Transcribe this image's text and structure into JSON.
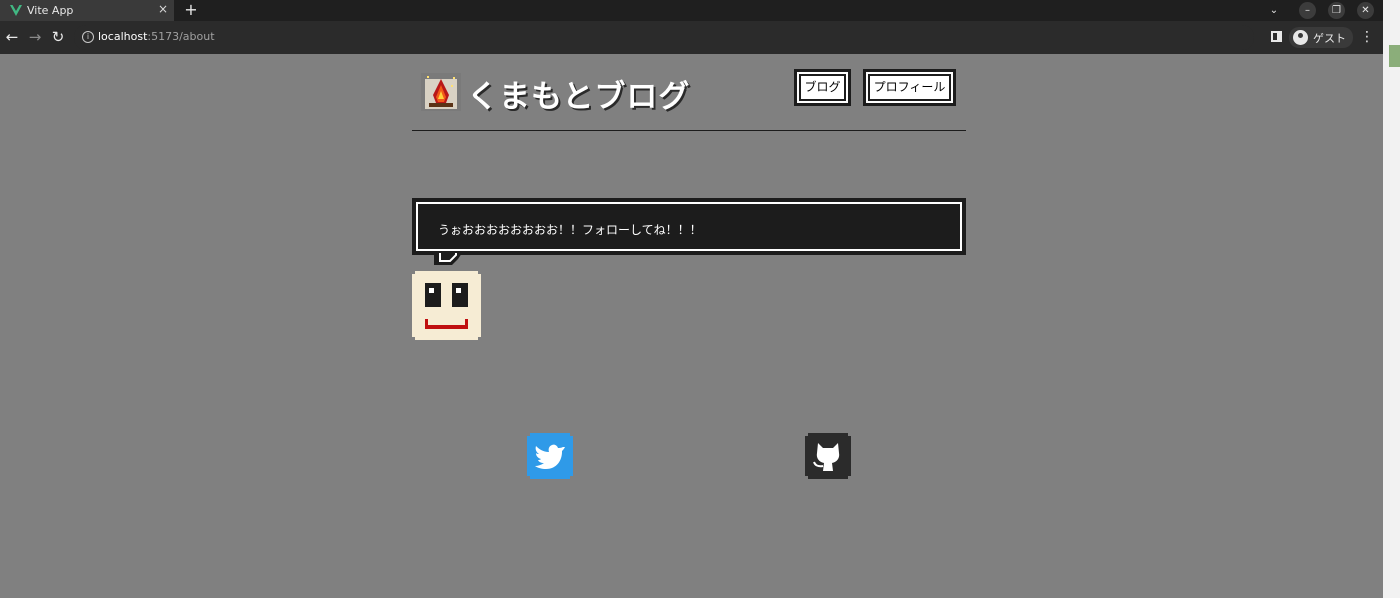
{
  "browser": {
    "tab_title": "Vite App",
    "tab_close": "×",
    "new_tab": "+",
    "url_host": "localhost",
    "url_path": ":5173/about",
    "profile_name": "ゲスト",
    "window_controls": [
      "–",
      "❐",
      "✕"
    ],
    "tab_search": "⌄",
    "menu": "⋮",
    "nav": {
      "back": "←",
      "forward": "→",
      "reload": "↻"
    },
    "info": "i"
  },
  "header": {
    "site_title": "くまもとブログ",
    "nav": [
      {
        "label": "ブログ"
      },
      {
        "label": "プロフィール"
      }
    ]
  },
  "speech": {
    "text": "うぉおおおおおおおお！！フォローしてね！！！"
  },
  "social": {
    "links": [
      {
        "name": "twitter-icon"
      },
      {
        "name": "github-icon"
      }
    ]
  },
  "colors": {
    "background": "#808080",
    "text": "#ffffff",
    "box_dark": "#1c1c1c",
    "twitter": "#2f9ae8",
    "face": "#f6ecd4",
    "mouth": "#c01010"
  }
}
